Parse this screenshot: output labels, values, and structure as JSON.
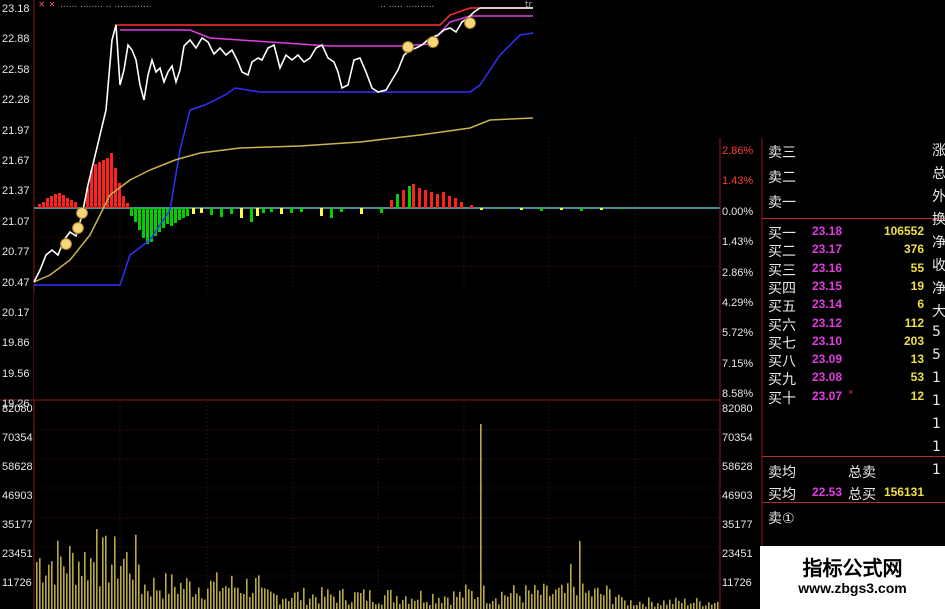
{
  "header": {
    "marks": "× ×",
    "status_left": "...... ........ .. .............",
    "status_mid": ".. ..... ..........",
    "status_right": "tr"
  },
  "price_axis_left": [
    "23.18",
    "22.88",
    "22.58",
    "22.28",
    "21.97",
    "21.67",
    "21.37",
    "21.07",
    "20.77",
    "20.47",
    "20.17",
    "19.86",
    "19.56",
    "19.26"
  ],
  "pct_axis_right": [
    "2.86%",
    "1.43%",
    "0.00%",
    "1.43%",
    "2.86%",
    "4.29%",
    "5.72%",
    "7.15%",
    "8.58%"
  ],
  "volume_axis_left": [
    "82080",
    "70354",
    "58628",
    "46903",
    "35177",
    "23451",
    "11726"
  ],
  "volume_axis_right": [
    "82080",
    "70354",
    "58628",
    "46903",
    "35177",
    "23451",
    "11726"
  ],
  "order_book": {
    "sell": [
      {
        "name": "卖三"
      },
      {
        "name": "卖二"
      },
      {
        "name": "卖一"
      }
    ],
    "buy": [
      {
        "name": "买一",
        "price": "23.18",
        "vol": "106552"
      },
      {
        "name": "买二",
        "price": "23.17",
        "vol": "376"
      },
      {
        "name": "买三",
        "price": "23.16",
        "vol": "55"
      },
      {
        "name": "买四",
        "price": "23.15",
        "vol": "19"
      },
      {
        "name": "买五",
        "price": "23.14",
        "vol": "6"
      },
      {
        "name": "买六",
        "price": "23.12",
        "vol": "112"
      },
      {
        "name": "买七",
        "price": "23.10",
        "vol": "203"
      },
      {
        "name": "买八",
        "price": "23.09",
        "vol": "13"
      },
      {
        "name": "买九",
        "price": "23.08",
        "vol": "53"
      },
      {
        "name": "买十",
        "price": "23.07",
        "vol": "12",
        "flag": "×"
      }
    ],
    "sell_avg_label": "卖均",
    "total_sell_label": "总卖",
    "buy_avg_label": "买均",
    "buy_avg": "22.53",
    "total_buy_label": "总买",
    "total_buy": "156131",
    "sell_one_label": "卖①"
  },
  "right_column": [
    "涨",
    "总",
    "外",
    "换",
    "净",
    "收",
    "净",
    "大",
    "5",
    "5",
    "1",
    "1",
    "1",
    "1",
    "1"
  ],
  "watermark": {
    "title": "指标公式网",
    "url": "www.zbgs3.com"
  },
  "colors": {
    "up": "#ff2020",
    "down": "#00d000",
    "price_line": "#ffffff",
    "avg_line": "#c8b450",
    "resistance": "#e23ce2",
    "support": "#3030ff",
    "volume": "#b8a840"
  }
}
